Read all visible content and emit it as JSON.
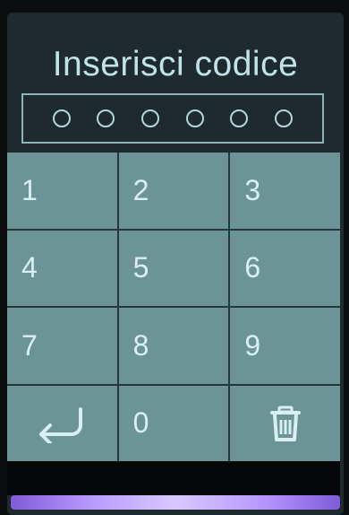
{
  "title": "Inserisci codice",
  "code": {
    "length": 6,
    "entered": 0
  },
  "keys": [
    {
      "label": "1"
    },
    {
      "label": "2"
    },
    {
      "label": "3"
    },
    {
      "label": "4"
    },
    {
      "label": "5"
    },
    {
      "label": "6"
    },
    {
      "label": "7"
    },
    {
      "label": "8"
    },
    {
      "label": "9"
    },
    {
      "icon": "return-arrow-icon"
    },
    {
      "label": "0"
    },
    {
      "icon": "trash-icon"
    }
  ],
  "colors": {
    "key_bg": "#6c9396",
    "text": "#d9f0f1",
    "accent_glow": "#b89bff"
  }
}
